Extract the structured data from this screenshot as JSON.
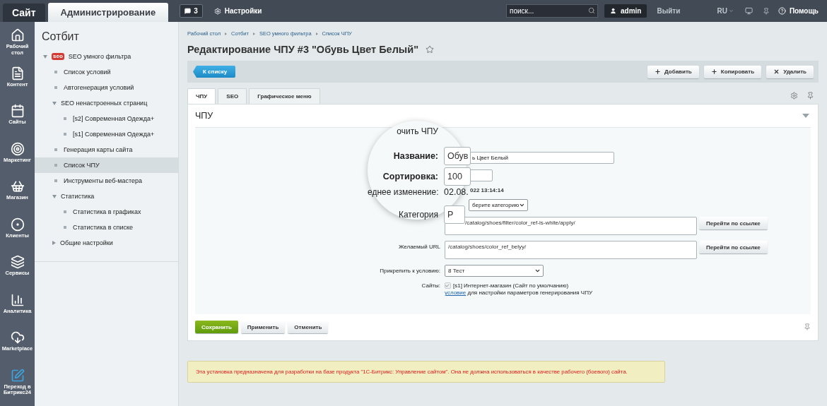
{
  "top_bar": {
    "tabs": [
      {
        "label": "Сайт",
        "selected": false
      },
      {
        "label": "Администрирование",
        "selected": true
      }
    ],
    "notifications": "3",
    "settings": "Настройки",
    "search": {
      "placeholder": "поиск..."
    },
    "user": "admin",
    "logout": "Выйти",
    "language": "RU",
    "help": "Помощь"
  },
  "side_nav": [
    {
      "label": "Рабочий стол"
    },
    {
      "label": "Контент"
    },
    {
      "label": "Сайты"
    },
    {
      "label": "Маркетинг"
    },
    {
      "label": "Магазин"
    },
    {
      "label": "Клиенты"
    },
    {
      "label": "Сервисы"
    },
    {
      "label": "Аналитика"
    },
    {
      "label": "Marketplace"
    },
    {
      "label": "Переход в Битрикс24"
    }
  ],
  "tree": {
    "title": "Сотбит",
    "items": [
      {
        "label": "SEO умного фильтра",
        "expanded": true,
        "selected": false,
        "badge": "seo",
        "children": [
          {
            "label": "Список условий",
            "selected": false
          },
          {
            "label": "Автогенерация условий",
            "selected": false
          },
          {
            "label": "SEO ненастроенных страниц",
            "expanded": true,
            "selected": false,
            "children": [
              {
                "label": "[s2] Современная Одежда+",
                "selected": false
              },
              {
                "label": "[s1] Современная Одежда+",
                "selected": false
              }
            ]
          },
          {
            "label": "Генерация карты сайта",
            "selected": false
          },
          {
            "label": "Список ЧПУ",
            "selected": true
          },
          {
            "label": "Инструменты веб-мастера",
            "selected": false
          },
          {
            "label": "Статистика",
            "expanded": true,
            "selected": false,
            "children": [
              {
                "label": "Статистика в графиках",
                "selected": false
              },
              {
                "label": "Статистика в списке",
                "selected": false
              }
            ]
          },
          {
            "label": "Общие настройки",
            "expanded": false,
            "selected": false
          }
        ]
      }
    ]
  },
  "breadcrumbs": [
    "Рабочий стол",
    "Сотбит",
    "SEO умного фильтра",
    "Список ЧПУ"
  ],
  "page_title": "Редактирование ЧПУ #3 \"Обувь Цвет Белый\"",
  "starred": false,
  "toolbar": {
    "back": "К списку",
    "actions": [
      "Добавить",
      "Копировать",
      "Удалить"
    ]
  },
  "tabs": [
    {
      "label": "ЧПУ",
      "selected": true
    },
    {
      "label": "SEO",
      "selected": false
    },
    {
      "label": "Графическое меню",
      "selected": false
    }
  ],
  "section": {
    "title": "ЧПУ",
    "expanded": true
  },
  "form_rows": [
    {
      "kind": "input",
      "value": "ь Цвет Белый"
    },
    {
      "kind": "short-input"
    },
    {
      "kind": "plain",
      "value": "022 13:14:14"
    },
    {
      "kind": "select",
      "value": "берите категорию"
    },
    {
      "kind": "textarea",
      "value": "/catalog/shoes/filter/color_ref-is-white/apply/",
      "button": "Перейти по ссылке"
    },
    {
      "kind": "textarea",
      "label": "Желаемый URL",
      "value": "/catalog/shoes/color_ref_belyy/",
      "button": "Перейти по ссылке"
    },
    {
      "kind": "select",
      "label": "Прикрепить к условию:",
      "value": "8 Тест"
    },
    {
      "kind": "sites",
      "label": "Сайты:",
      "checked": true,
      "disabled": true,
      "value": "[s1] Интернет-магазин (Сайт по умолчанию)",
      "link": "условие",
      "note": "для настройки параметров генерирования ЧПУ"
    }
  ],
  "magnifier": [
    {
      "kind": "label",
      "label": "очить ЧПУ"
    },
    {
      "kind": "input",
      "label": "Название:",
      "bold": true,
      "value": "Обув"
    },
    {
      "kind": "input",
      "label": "Сортировка:",
      "bold": true,
      "value": "100"
    },
    {
      "kind": "plain",
      "label": "еднее изменение:",
      "bold": false,
      "value": "02.08."
    },
    {
      "kind": "select",
      "label": "Категория",
      "bold": false,
      "value": "Р"
    }
  ],
  "buttons": [
    {
      "label": "Сохранить",
      "primary": true
    },
    {
      "label": "Применить",
      "primary": false
    },
    {
      "label": "Отменить",
      "primary": false
    }
  ],
  "warning": "Эта установка предназначена для разработки на базе продукта \"1С-Битрикс: Управление сайтом\". Она не должна использоваться в качестве рабочего (боевого) сайта."
}
